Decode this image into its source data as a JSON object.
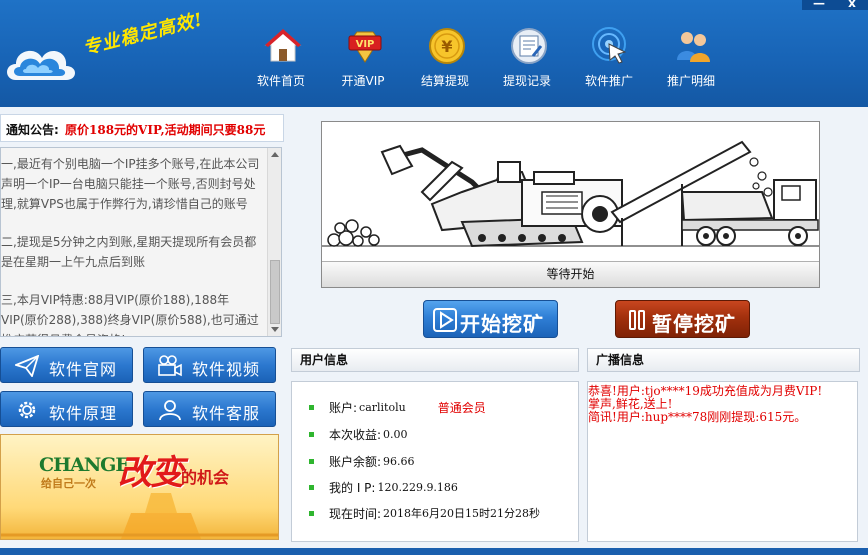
{
  "window": {
    "min_label": "—",
    "close_label": "x"
  },
  "brand": {
    "slogan": "专业稳定高效!"
  },
  "nav": [
    {
      "label": "软件首页",
      "icon": "home-icon"
    },
    {
      "label": "开通VIP",
      "icon": "vip-icon",
      "badge": "VIP"
    },
    {
      "label": "结算提现",
      "icon": "yuan-coin-icon",
      "badge": "¥"
    },
    {
      "label": "提现记录",
      "icon": "record-icon"
    },
    {
      "label": "软件推广",
      "icon": "promote-cursor-icon"
    },
    {
      "label": "推广明细",
      "icon": "users-icon"
    }
  ],
  "notice": {
    "label": "通知公告:",
    "text": "原价188元的VIP,活动期间只要88元"
  },
  "announcements": [
    "一,最近有个别电脑一个IP挂多个账号,在此本公司声明一个IP一台电脑只能挂一个账号,否则封号处理,就算VPS也属于作弊行为,请珍惜自己的账号",
    "二,提现是5分钟之内到账,星期天提现所有会员都是在星期一上午九点后到账",
    "三,本月VIP特惠:88月VIP(原价188),188年VIP(原价288),388)终身VIP(原价588),也可通过推广获得月费会员资格!"
  ],
  "side_buttons": {
    "website": "软件官网",
    "video": "软件视频",
    "principle": "软件原理",
    "service": "软件客服"
  },
  "banner": {
    "latin": "CHANGE",
    "sub": "给自己一次",
    "big": "改变",
    "tail": "的机会"
  },
  "mining": {
    "status": "等待开始",
    "progress": 0
  },
  "actions": {
    "start": "开始挖矿",
    "stop": "暂停挖矿"
  },
  "user_info": {
    "title": "用户信息",
    "account_label": "账户:",
    "account": "carlitolu",
    "level": "普通会员",
    "income_label": "本次收益:",
    "income": "0.00",
    "balance_label": "账户余额:",
    "balance": "96.66",
    "ip_label": "我的 I P:",
    "ip": "120.229.9.186",
    "time_label": "现在时间:",
    "time": "2018年6月20日15时21分28秒"
  },
  "broadcast": {
    "title": "广播信息",
    "lines": [
      "恭喜!用户:tjo****19成功充值成为月费VIP!",
      "掌声,鲜花,送上!",
      "简讯!用户:hup****78刚刚提现:615元。"
    ]
  },
  "colors": {
    "header_blue": "#1864b6",
    "accent_red": "#e10000",
    "start_blue": "#2f7fd6",
    "stop_red": "#a2300d"
  }
}
